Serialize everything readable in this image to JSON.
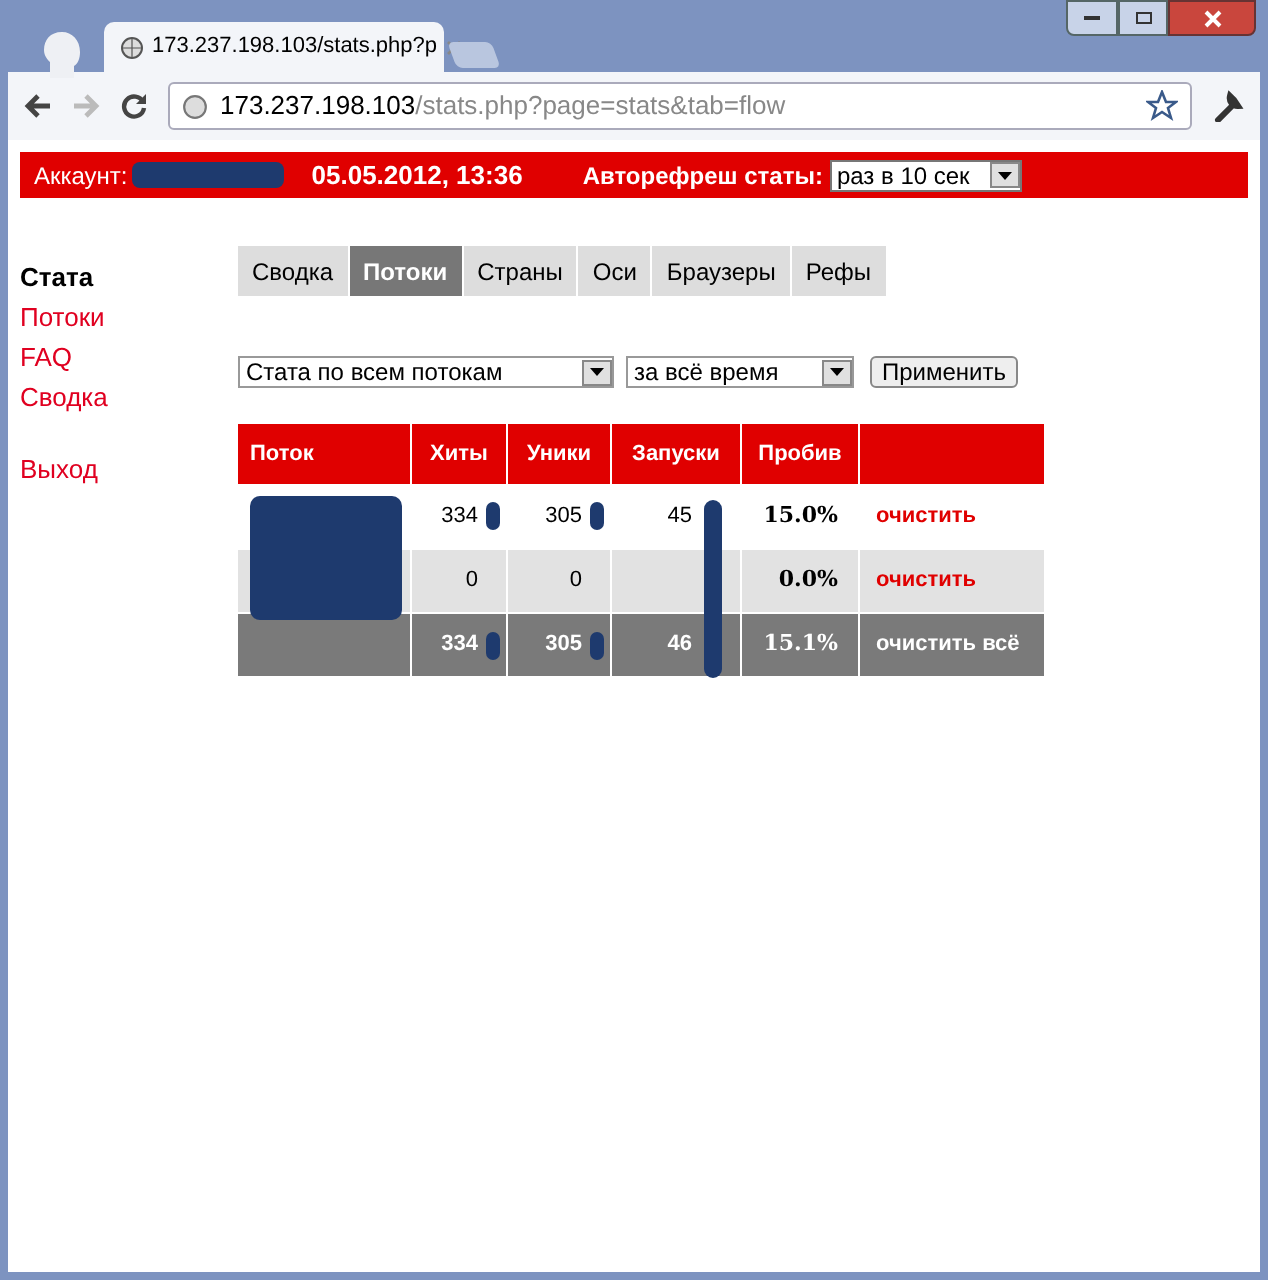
{
  "browser": {
    "tab_title": "173.237.198.103/stats.php?p",
    "address_host": "173.237.198.103",
    "address_path": "/stats.php?page=stats&tab=flow"
  },
  "header": {
    "account_label": "Аккаунт:",
    "datetime": "05.05.2012, 13:36",
    "refresh_label": "Авторефреш статы:",
    "refresh_value": "раз в 10 сек"
  },
  "sidebar": {
    "items": [
      {
        "label": "Стата",
        "selected": true
      },
      {
        "label": "Потоки",
        "selected": false
      },
      {
        "label": "FAQ",
        "selected": false
      },
      {
        "label": "Сводка",
        "selected": false
      },
      {
        "label": "Выход",
        "selected": false
      }
    ]
  },
  "tabs": [
    {
      "label": "Сводка",
      "selected": false
    },
    {
      "label": "Потоки",
      "selected": true
    },
    {
      "label": "Страны",
      "selected": false
    },
    {
      "label": "Оси",
      "selected": false
    },
    {
      "label": "Браузеры",
      "selected": false
    },
    {
      "label": "Рефы",
      "selected": false
    }
  ],
  "filters": {
    "scope": "Стата по всем потокам",
    "period": "за всё время",
    "apply": "Применить"
  },
  "table": {
    "columns": [
      "Поток",
      "Хиты",
      "Уники",
      "Запуски",
      "Пробив"
    ],
    "rows": [
      {
        "kind": "row",
        "cells": [
          "",
          "334",
          "305",
          "45",
          "15.0%"
        ],
        "action": "очистить"
      },
      {
        "kind": "row",
        "cells": [
          "",
          "0",
          "0",
          "",
          "0.0%"
        ],
        "action": "очистить"
      },
      {
        "kind": "total",
        "cells": [
          "",
          "334",
          "305",
          "46",
          "15.1%"
        ],
        "action": "очистить всё"
      }
    ]
  }
}
